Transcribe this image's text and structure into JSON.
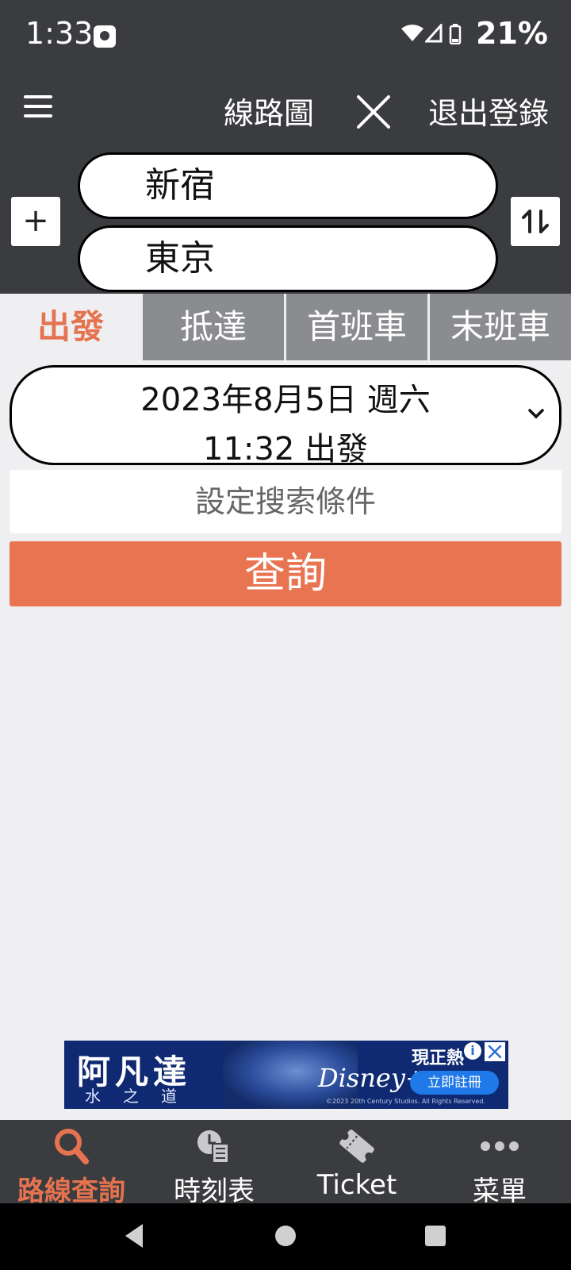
{
  "status_bar": {
    "time": "1:33",
    "battery": "21%"
  },
  "header": {
    "route_map_label": "線路圖",
    "logout_label": "退出登錄"
  },
  "stations": {
    "from": "新宿",
    "to": "東京",
    "add_label": "+"
  },
  "tabs": [
    {
      "label": "出發",
      "active": true
    },
    {
      "label": "抵達",
      "active": false
    },
    {
      "label": "首班車",
      "active": false
    },
    {
      "label": "末班車",
      "active": false
    }
  ],
  "date_selector": {
    "date": "2023年8月5日 週六",
    "time": "11:32 出發"
  },
  "conditions_label": "設定搜索條件",
  "query_label": "查詢",
  "ad": {
    "title": "阿凡達",
    "subtitle": "水之道",
    "brand": "Disney+",
    "now_label": "現正熱",
    "cta": "立即註冊",
    "copyright": "©2023 20th Century Studios. All Rights Reserved."
  },
  "bottom_nav": [
    {
      "label": "路線查詢",
      "icon": "search-icon",
      "active": true
    },
    {
      "label": "時刻表",
      "icon": "timetable-icon",
      "active": false
    },
    {
      "label": "Ticket",
      "icon": "ticket-icon",
      "active": false
    },
    {
      "label": "菜單",
      "icon": "more-icon",
      "active": false
    }
  ],
  "colors": {
    "accent": "#e87451",
    "header_bg": "#3b3c3f",
    "tab_inactive": "#8b8c90"
  }
}
